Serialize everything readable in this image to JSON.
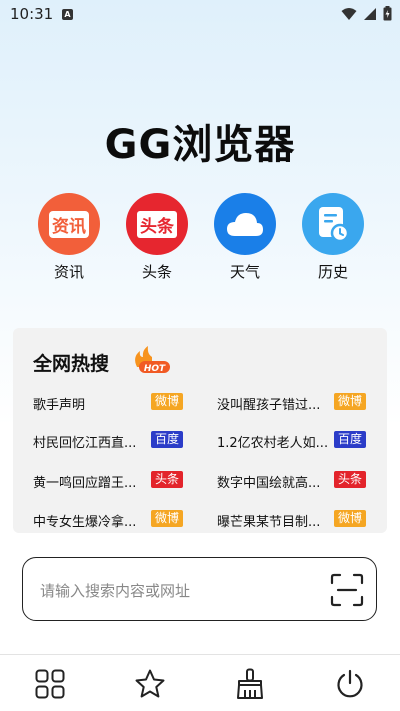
{
  "status_bar": {
    "time": "10:31",
    "notification_icon": "A"
  },
  "app": {
    "title": "GG浏览器"
  },
  "shortcuts": [
    {
      "label": "资讯",
      "icon_text": "资讯",
      "icon": "news-icon",
      "color": "#f25f3a"
    },
    {
      "label": "头条",
      "icon_text": "头条",
      "icon": "headline-icon",
      "color": "#e6262f"
    },
    {
      "label": "天气",
      "icon": "cloud-icon",
      "color": "#1a7fe8"
    },
    {
      "label": "历史",
      "icon": "history-icon",
      "color": "#3aa7ee"
    }
  ],
  "hot_search": {
    "title": "全网热搜",
    "hot_badge": "HOT",
    "items": [
      {
        "text": "歌手声明",
        "source": "微博",
        "source_color": "#f5a623"
      },
      {
        "text": "没叫醒孩子错过...",
        "source": "微博",
        "source_color": "#f5a623"
      },
      {
        "text": "村民回忆江西直...",
        "source": "百度",
        "source_color": "#2b3cc8"
      },
      {
        "text": "1.2亿农村老人如...",
        "source": "百度",
        "source_color": "#2b3cc8"
      },
      {
        "text": "黄一鸣回应蹭王...",
        "source": "头条",
        "source_color": "#e3242b"
      },
      {
        "text": "数字中国绘就高...",
        "source": "头条",
        "source_color": "#e3242b"
      },
      {
        "text": "中专女生爆冷拿...",
        "source": "微博",
        "source_color": "#f5a623"
      },
      {
        "text": "曝芒果某节目制...",
        "source": "微博",
        "source_color": "#f5a623"
      }
    ]
  },
  "search": {
    "placeholder": "请输入搜索内容或网址"
  },
  "bottom_nav": [
    {
      "name": "grid-menu-icon"
    },
    {
      "name": "star-icon"
    },
    {
      "name": "broom-icon"
    },
    {
      "name": "power-icon"
    }
  ]
}
